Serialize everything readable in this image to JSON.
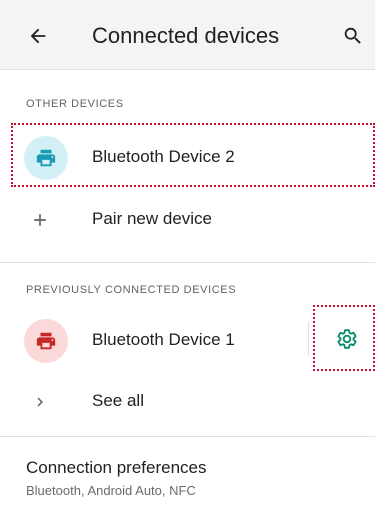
{
  "appbar": {
    "title": "Connected devices",
    "back_icon": "arrow-back-icon",
    "search_icon": "search-icon"
  },
  "sections": {
    "other": {
      "header": "OTHER DEVICES",
      "device": {
        "name": "Bluetooth Device 2",
        "icon": "printer-icon",
        "icon_bg": "#d3f0f7",
        "icon_color": "#1a9bb5"
      },
      "pair": {
        "label": "Pair new device",
        "icon": "plus-icon"
      }
    },
    "previous": {
      "header": "PREVIOUSLY CONNECTED DEVICES",
      "device": {
        "name": "Bluetooth Device 1",
        "icon": "printer-icon",
        "icon_bg": "#fbd9d9",
        "icon_color": "#c62828",
        "settings_icon": "gear-icon",
        "settings_color": "#0a8a6d"
      },
      "see_all": {
        "label": "See all",
        "icon": "chevron-right-icon"
      }
    }
  },
  "preferences": {
    "title": "Connection preferences",
    "subtitle": "Bluetooth, Android Auto, NFC"
  },
  "colors": {
    "highlight": "#c8102e",
    "appbar_bg": "#f4f4f4"
  }
}
